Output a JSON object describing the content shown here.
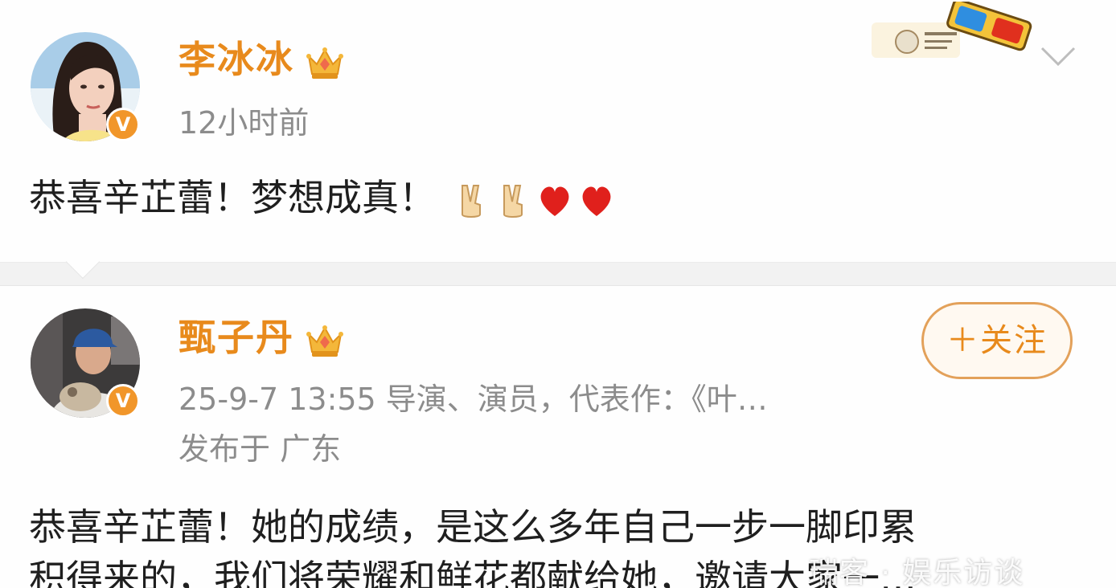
{
  "posts": [
    {
      "username": "李冰冰",
      "time": "12小时前",
      "content": "恭喜辛芷蕾！梦想成真！",
      "emojis": [
        "victory-hand",
        "victory-hand",
        "red-heart",
        "red-heart"
      ]
    },
    {
      "username": "甄子丹",
      "time_and_bio": "25-9-7 13:55  导演、演员，代表作：《叶…",
      "location": "发布于 广东",
      "follow_label": "＋关注",
      "content_line1": "恭喜辛芷蕾！她的成绩，是这么多年自己一步一脚印累",
      "content_line2": "积得来的，我们将荣耀和鲜花都献给她，邀请大家一…"
    }
  ],
  "verified_badge_letter": "V",
  "watermark": "瑞客 · 娱乐访谈"
}
